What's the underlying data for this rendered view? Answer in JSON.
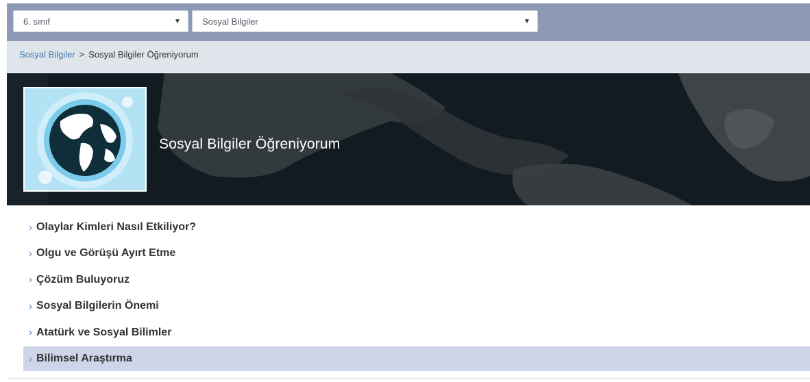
{
  "filters": {
    "class_value": "6. sınıf",
    "subject_value": "Sosyal Bilgiler",
    "arrow_glyph": "▼"
  },
  "breadcrumb": {
    "parent": "Sosyal Bilgiler",
    "separator": ">",
    "current": "Sosyal Bilgiler Öğreniyorum"
  },
  "hero": {
    "title": "Sosyal Bilgiler Öğreniyorum",
    "thumbnail_icon": "globe-icon"
  },
  "topics": {
    "chevron": "›",
    "items": [
      {
        "label": "Olaylar Kimleri Nasıl Etkiliyor?",
        "active": false
      },
      {
        "label": "Olgu ve Görüşü Ayırt Etme",
        "active": false
      },
      {
        "label": "Çözüm Buluyoruz",
        "active": false
      },
      {
        "label": "Sosyal Bilgilerin Önemi",
        "active": false
      },
      {
        "label": "Atatürk ve Sosyal Bilimler",
        "active": false
      },
      {
        "label": "Bilimsel Araştırma",
        "active": true
      }
    ]
  },
  "colors": {
    "topbar": "#8d9ab5",
    "breadcrumb_bg": "#dfe5ea",
    "link": "#3f78b5",
    "hero_bg": "#121c22",
    "active_row": "#cfd5e8"
  }
}
